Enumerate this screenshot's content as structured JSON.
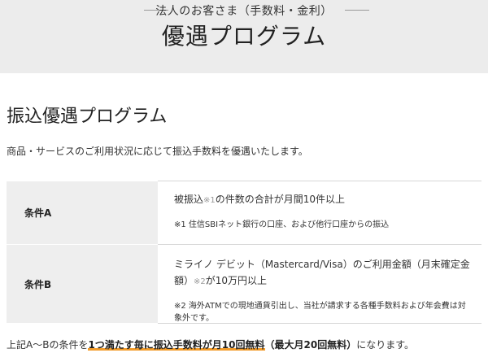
{
  "hero": {
    "subtitle": "法人のお客さま（手数料・金利）",
    "title": "優遇プログラム"
  },
  "section": {
    "title": "振込優遇プログラム",
    "lead": "商品・サービスのご利用状況に応じて振込手数料を優遇いたします。"
  },
  "conditions": [
    {
      "label": "条件A",
      "text_before": "被振込",
      "note_mark": "※1",
      "text_after": "の件数の合計が月間10件以上",
      "note": "※1 住信SBIネット銀行の口座、および他行口座からの振込"
    },
    {
      "label": "条件B",
      "text_before": "ミライノ デビット（Mastercard/Visa）のご利用金額（月末確定金額）",
      "note_mark": "※2",
      "text_after": "が10万円以上",
      "note": "※2 海外ATMでの現地通貨引出し、当社が請求する各種手数料および年会費は対象外です。"
    }
  ],
  "bottom": {
    "prefix": "上記A～Bの条件を",
    "highlight": "1つ満たす毎に振込手数料が月10回無料",
    "bold_rest": "（最大月20回無料）",
    "suffix": "になります。"
  },
  "colors": {
    "hero_bg": "#ececec",
    "table_header_bg": "#eeeeee",
    "underline_accent": "#f39c2a"
  }
}
